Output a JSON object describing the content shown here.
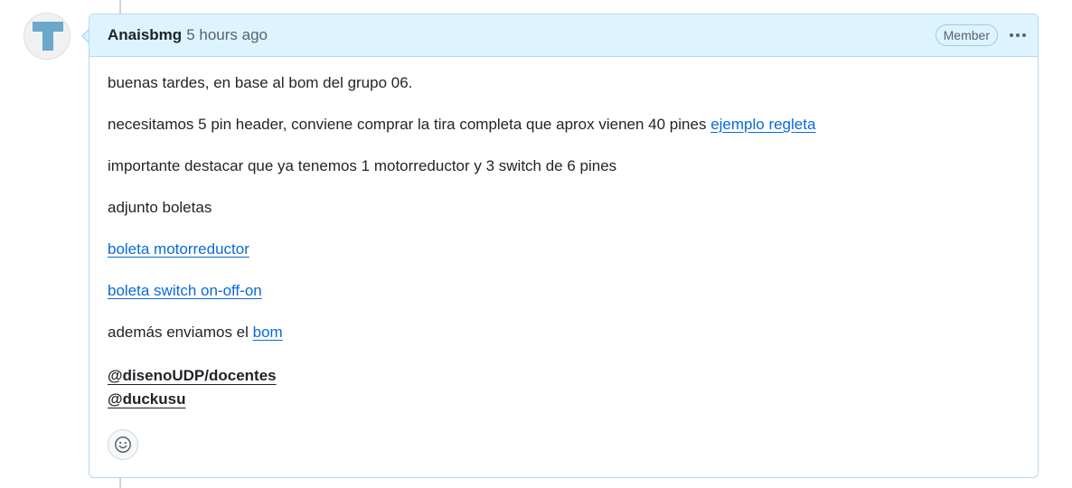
{
  "comment": {
    "author": "Anaisbmg",
    "timestamp": "5 hours ago",
    "role_badge": "Member",
    "body": {
      "line1": "buenas tardes, en base al bom del grupo 06.",
      "line2_text": "necesitamos 5 pin header, conviene comprar la tira completa que aprox vienen 40 pines ",
      "line2_link": "ejemplo regleta",
      "line3": "importante destacar que ya tenemos 1 motorreductor y 3 switch de 6 pines",
      "line4": "adjunto boletas",
      "link_boleta_motor": "boleta motorreductor",
      "link_boleta_switch": "boleta switch on-off-on",
      "line7_text": "además enviamos el ",
      "line7_link": "bom",
      "mention_team": "@disenoUDP/docentes",
      "mention_user": "@duckusu"
    }
  },
  "icons": {
    "avatar": "identicon-avatar",
    "menu": "kebab-horizontal-icon",
    "reaction": "smiley-icon"
  },
  "colors": {
    "header_bg": "#ddf4ff",
    "border": "#b6d7f0",
    "link": "#0969da",
    "avatar_accent": "#6aa9c8"
  }
}
